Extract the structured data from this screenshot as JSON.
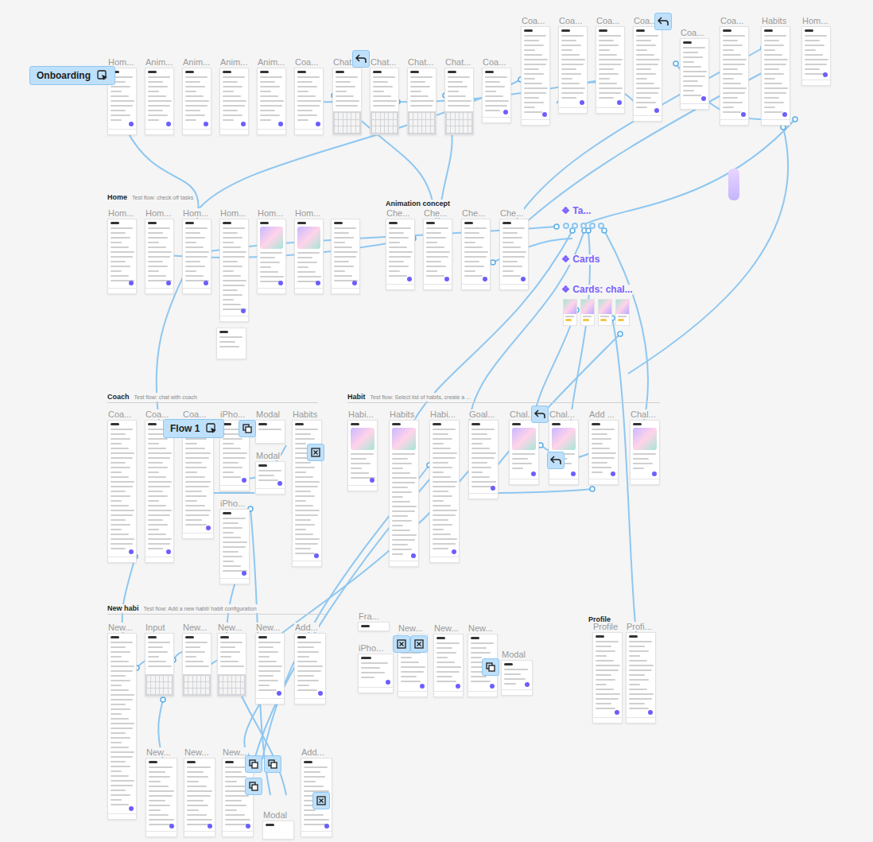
{
  "flow_starts": [
    {
      "label": "Onboarding"
    },
    {
      "label": "Flow 1"
    }
  ],
  "sections": [
    {
      "title": "Home",
      "note": "Test flow: check off tasks"
    },
    {
      "title": "Animation concept",
      "note": ""
    },
    {
      "title": "Coach",
      "note": "Test flow: chat with coach"
    },
    {
      "title": "Habit",
      "note": "Test flow: Select list of habits, create a ..."
    },
    {
      "title": "New habi",
      "note": "Test flow: Add a new habit/ habit configuration"
    },
    {
      "title": "Profile",
      "note": ""
    }
  ],
  "components": [
    {
      "label": "❖ Ta..."
    },
    {
      "label": "❖ Cards"
    },
    {
      "label": "❖ Cards: chal..."
    }
  ],
  "frames": [
    {
      "title": "Hom...",
      "kind": "screen"
    },
    {
      "title": "Anim...",
      "kind": "screen"
    },
    {
      "title": "Anim...",
      "kind": "screen"
    },
    {
      "title": "Anim...",
      "kind": "screen"
    },
    {
      "title": "Anim...",
      "kind": "screen"
    },
    {
      "title": "Coa...",
      "kind": "screen"
    },
    {
      "title": "Chat...",
      "kind": "chat"
    },
    {
      "title": "Chat...",
      "kind": "chat"
    },
    {
      "title": "Chat...",
      "kind": "chat"
    },
    {
      "title": "Chat...",
      "kind": "chat"
    },
    {
      "title": "Coa...",
      "kind": "screen"
    },
    {
      "title": "Coa...",
      "kind": "text"
    },
    {
      "title": "Coa...",
      "kind": "text"
    },
    {
      "title": "Coa...",
      "kind": "text"
    },
    {
      "title": "Coa...",
      "kind": "text"
    },
    {
      "title": "Coa...",
      "kind": "text"
    },
    {
      "title": "Coa...",
      "kind": "text"
    },
    {
      "title": "Habits",
      "kind": "screen"
    },
    {
      "title": "Hom...",
      "kind": "screen"
    },
    {
      "title": "Hom...",
      "kind": "screen"
    },
    {
      "title": "Hom...",
      "kind": "screen"
    },
    {
      "title": "Hom...",
      "kind": "screen"
    },
    {
      "title": "Hom...",
      "kind": "screen"
    },
    {
      "title": "Hom...",
      "kind": "art"
    },
    {
      "title": "Hom...",
      "kind": "art"
    },
    {
      "title": "",
      "kind": "screen"
    },
    {
      "title": "Che...",
      "kind": "screen"
    },
    {
      "title": "Che...",
      "kind": "screen"
    },
    {
      "title": "Che...",
      "kind": "screen"
    },
    {
      "title": "Che...",
      "kind": "screen"
    },
    {
      "title": "",
      "kind": "screen"
    },
    {
      "title": "Coa...",
      "kind": "text"
    },
    {
      "title": "Coa...",
      "kind": "text"
    },
    {
      "title": "Coa...",
      "kind": "text"
    },
    {
      "title": "iPho...",
      "kind": "screen"
    },
    {
      "title": "iPho...",
      "kind": "screen"
    },
    {
      "title": "Modal",
      "kind": "screen"
    },
    {
      "title": "Modal",
      "kind": "screen"
    },
    {
      "title": "Habits",
      "kind": "screen"
    },
    {
      "title": "Habi...",
      "kind": "art"
    },
    {
      "title": "Habits",
      "kind": "art"
    },
    {
      "title": "Habi...",
      "kind": "screen"
    },
    {
      "title": "Goal...",
      "kind": "screen"
    },
    {
      "title": "Chal...",
      "kind": "art"
    },
    {
      "title": "Chal...",
      "kind": "art"
    },
    {
      "title": "Add ...",
      "kind": "screen"
    },
    {
      "title": "Chal...",
      "kind": "art"
    },
    {
      "title": "New...",
      "kind": "screen"
    },
    {
      "title": "Input",
      "kind": "chat"
    },
    {
      "title": "New...",
      "kind": "chat"
    },
    {
      "title": "New...",
      "kind": "chat"
    },
    {
      "title": "New...",
      "kind": "screen"
    },
    {
      "title": "Add...",
      "kind": "screen"
    },
    {
      "title": "Fra...",
      "kind": "screen"
    },
    {
      "title": "iPho...",
      "kind": "screen"
    },
    {
      "title": "New...",
      "kind": "screen"
    },
    {
      "title": "New...",
      "kind": "screen"
    },
    {
      "title": "New...",
      "kind": "screen"
    },
    {
      "title": "Modal",
      "kind": "screen"
    },
    {
      "title": "Profile",
      "kind": "screen"
    },
    {
      "title": "Profi...",
      "kind": "screen"
    },
    {
      "title": "New...",
      "kind": "screen"
    },
    {
      "title": "New...",
      "kind": "screen"
    },
    {
      "title": "New...",
      "kind": "screen"
    },
    {
      "title": "Modal",
      "kind": "screen"
    },
    {
      "title": "Add...",
      "kind": "screen"
    }
  ]
}
